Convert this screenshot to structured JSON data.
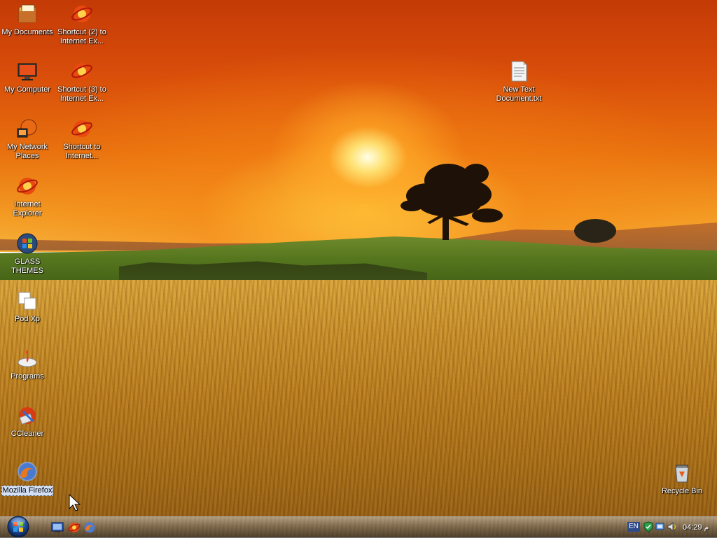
{
  "desktop": {
    "icons": [
      {
        "label": "My Documents",
        "icon": "my-documents-icon"
      },
      {
        "label": "Shortcut (2) to Internet Ex...",
        "icon": "internet-explorer-icon"
      },
      {
        "label": "My Computer",
        "icon": "my-computer-icon"
      },
      {
        "label": "Shortcut (3) to Internet Ex...",
        "icon": "internet-explorer-icon"
      },
      {
        "label": "New Text Document.txt",
        "icon": "text-document-icon"
      },
      {
        "label": "My Network Places",
        "icon": "network-places-icon"
      },
      {
        "label": "Shortcut to Internet...",
        "icon": "internet-explorer-icon"
      },
      {
        "label": "Internet Explorer",
        "icon": "internet-explorer-icon"
      },
      {
        "label": "GLASS THEMES",
        "icon": "windows-orb-icon"
      },
      {
        "label": "Pod Xp",
        "icon": "pod-xp-icon"
      },
      {
        "label": "Programs",
        "icon": "programs-icon"
      },
      {
        "label": "CCleaner",
        "icon": "ccleaner-icon"
      },
      {
        "label": "Mozilla Firefox",
        "icon": "firefox-icon",
        "selected": true
      },
      {
        "label": "Recycle Bin",
        "icon": "recycle-bin-icon"
      }
    ]
  },
  "taskbar": {
    "start_icon": "windows-start-orb-icon",
    "quick_launch": [
      "show-desktop-icon",
      "internet-explorer-icon",
      "firefox-icon"
    ],
    "tray": {
      "language": "EN",
      "icons": [
        "security-shield-icon",
        "network-icon",
        "volume-icon"
      ],
      "clock": "04:29 م"
    }
  },
  "colors": {
    "sky_top": "#c43a06",
    "field": "#c98f2a",
    "selection_bg": "#d3e0f5"
  }
}
